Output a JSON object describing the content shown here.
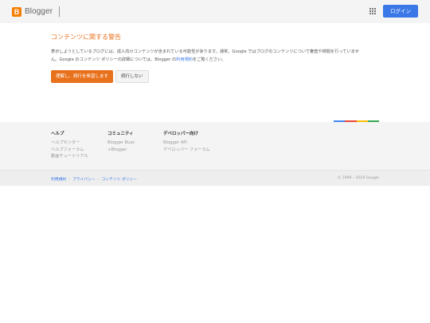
{
  "header": {
    "logo_letter": "B",
    "logo_text": "Blogger",
    "login_label": "ログイン"
  },
  "main": {
    "title": "コンテンツに関する警告",
    "body_line1": "表示しようとしているブログには、成人向けコンテンツが含まれている可能性があります。通常、Google ではブログのコンテンツについて審査や検閲を行っていませ",
    "body_line2_a": "ん。Google のコンテンツ ポリシーの詳細については、Blogger の",
    "body_link": "利用規約",
    "body_line2_b": "をご覧ください。",
    "continue_label": "理解し、続行を希望します",
    "cancel_label": "続行しない"
  },
  "footer": {
    "columns": [
      {
        "heading": "ヘルプ",
        "links": [
          "ヘルプセンター",
          "ヘルプフォーラム",
          "動画チュートリアル"
        ]
      },
      {
        "heading": "コミュニティ",
        "links": [
          "Blogger Buzz",
          "+Blogger"
        ]
      },
      {
        "heading": "デベロッパー向け",
        "links": [
          "Blogger API",
          "デベロッパー フォーラム"
        ]
      }
    ],
    "bottom_links": [
      "利用規約",
      "プライバシー",
      "コンテンツ ポリシー"
    ],
    "copyright": "© 1999 – 2019 Google"
  },
  "colors": {
    "brand_orange": "#f57d00",
    "title_orange": "#e8711c",
    "button_blue": "#3b78e7",
    "google_bar": [
      "#4285f4",
      "#ea4335",
      "#fbbc05",
      "#34a853"
    ]
  },
  "icons": [
    "blogger-logo-icon",
    "apps-grid-icon"
  ]
}
